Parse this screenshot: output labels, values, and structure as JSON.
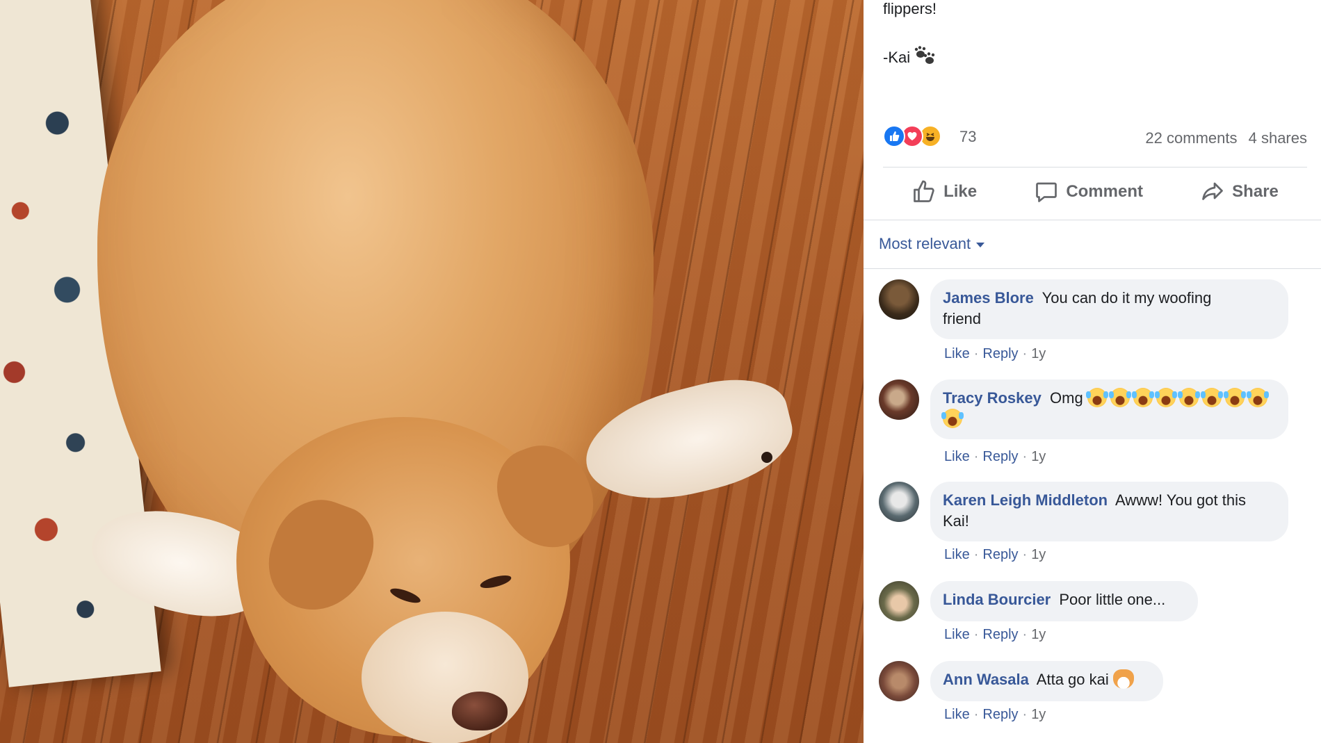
{
  "post": {
    "text_line_1": "flippers!",
    "signature": "-Kai",
    "signature_icon": "paw-prints-icon",
    "reaction_count": "73",
    "comments_count": "22 comments",
    "shares_count": "4 shares"
  },
  "actions": {
    "like": "Like",
    "comment": "Comment",
    "share": "Share"
  },
  "sort_label": "Most relevant",
  "colors": {
    "link_blue": "#385898",
    "like_blue": "#1877f2",
    "love_red": "#f33e58",
    "haha_yellow": "#f7b125",
    "bubble_bg": "#f0f2f5",
    "muted_text": "#65676b"
  },
  "comments": [
    {
      "name": "James Blore",
      "text_line_1": "You can do it my woofing",
      "text_line_2": "friend",
      "like": "Like",
      "reply": "Reply",
      "age": "1y"
    },
    {
      "name": "Tracy Roskey",
      "text": "Omg",
      "emoji_count": 9,
      "emoji_icon": "laughing-tears-emoji",
      "like": "Like",
      "reply": "Reply",
      "age": "1y"
    },
    {
      "name": "Karen Leigh Middleton",
      "text_line_1": "Awww! You got this",
      "text_line_2": "Kai!",
      "like": "Like",
      "reply": "Reply",
      "age": "1y"
    },
    {
      "name": "Linda Bourcier",
      "text": "Poor little one...",
      "like": "Like",
      "reply": "Reply",
      "age": "1y"
    },
    {
      "name": "Ann Wasala",
      "text": "Atta go kai",
      "emoji_icon": "dog-face-emoji",
      "like": "Like",
      "reply": "Reply",
      "age": "1y"
    }
  ]
}
